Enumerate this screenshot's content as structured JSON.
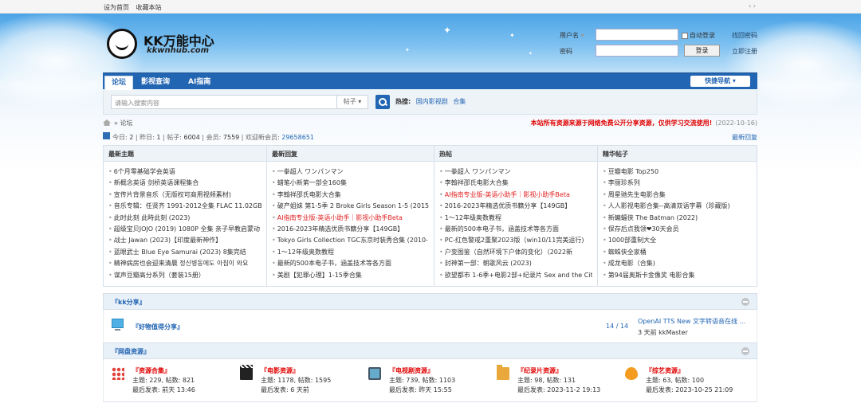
{
  "topbar": {
    "set_home": "设为首页",
    "bookmark": "收藏本站",
    "right": "‹ ›"
  },
  "logo": {
    "name": "KK万能中心",
    "url": "kkwnhub.com"
  },
  "login": {
    "username_label": "用户名",
    "password_label": "密码",
    "remember": "自动登录",
    "login_btn": "登录",
    "find_pwd": "找回密码",
    "register": "立即注册"
  },
  "nav": {
    "tabs": [
      "论坛",
      "影视查询",
      "AI指南"
    ],
    "quick": "快捷导航 ▾"
  },
  "search": {
    "placeholder": "请输入搜索内容",
    "type": "帖子 ▾",
    "hot_label": "热搜:",
    "hot_items": [
      "国内影视剧",
      "合集"
    ]
  },
  "breadcrumb": {
    "sep": "»",
    "current": "论坛",
    "notice": "本站所有资源来源于网络免费公开分享资源，仅供学习交流使用!",
    "date": "(2022-10-16)"
  },
  "stats": {
    "today_label": "今日:",
    "today": "2",
    "yesterday_label": "昨日:",
    "yesterday": "1",
    "posts_label": "帖子:",
    "posts": "6004",
    "members_label": "会员:",
    "members": "7559",
    "welcome_label": "欢迎新会员:",
    "new_member": "29658651",
    "latest_reply": "最新回复"
  },
  "columns": [
    {
      "title": "最新主题",
      "items": [
        {
          "text": "6个月零基础学会英语",
          "red": false
        },
        {
          "text": "新概念英语 剑桥英语课程集合",
          "red": false
        },
        {
          "text": "宣传片背景音乐（无版权可商用视频素材)",
          "red": false
        },
        {
          "text": "音乐专辑：任贤齐 1991-2012全集 FLAC 11.02GB",
          "red": false
        },
        {
          "text": "此时此刻 此時此刻 (2023)",
          "red": false
        },
        {
          "text": "超级宝贝JOJO (2019) 1080P 全集 亲子早教启蒙动",
          "red": false
        },
        {
          "text": "战士 Jawan (2023)【印度最新神作】",
          "red": false
        },
        {
          "text": "蓝眼武士 Blue Eye Samurai (2023) 8集完结",
          "red": false
        },
        {
          "text": "精神病房也会迎来清晨 정신병동에도 아침이 와요",
          "red": false
        },
        {
          "text": "谋声豆瓣高分系列（套装15册）",
          "red": false
        }
      ]
    },
    {
      "title": "最新回复",
      "items": [
        {
          "text": "一拳超人 ワンパンマン",
          "red": false
        },
        {
          "text": "蜡笔小新第一部全160集",
          "red": false
        },
        {
          "text": "李翰祥邵氏电影大合集",
          "red": false
        },
        {
          "text": "破产姐妹 第1-5季 2 Broke Girls Season 1-5 (2015)",
          "red": false
        },
        {
          "text": "AI指南专业版-英语小助手｜影视小助手Beta",
          "red": true
        },
        {
          "text": "2016-2023年精选优质书籍分享【149GB】",
          "red": false
        },
        {
          "text": "Tokyo Girls Collection TGC东京时装秀合集 (2010-",
          "red": false
        },
        {
          "text": "1～12年级奥数教程",
          "red": false
        },
        {
          "text": "最新的500本电子书，涵盖技术等各方面",
          "red": false
        },
        {
          "text": "美剧【犯罪心理】1-15季合集",
          "red": false
        }
      ]
    },
    {
      "title": "热帖",
      "items": [
        {
          "text": "一拳超人 ワンパンマン",
          "red": false
        },
        {
          "text": "李翰祥邵氏电影大合集",
          "red": false
        },
        {
          "text": "AI指南专业版-英语小助手｜影视小助手Beta",
          "red": true
        },
        {
          "text": "2016-2023年精选优质书籍分享【149GB】",
          "red": false
        },
        {
          "text": "1～12年级奥数教程",
          "red": false
        },
        {
          "text": "最新的500本电子书，涵盖技术等各方面",
          "red": false
        },
        {
          "text": "PC-红色警戒2重聚2023版（win10/11完美运行)",
          "red": false
        },
        {
          "text": "户变图鉴（自然环境下户体的变化）（2022新",
          "red": false
        },
        {
          "text": "封神第一部：朝歌风云 (2023)",
          "red": false
        },
        {
          "text": "欲望都市 1-6季+电影2部+纪录片 Sex and the City",
          "red": false
        }
      ]
    },
    {
      "title": "精华帖子",
      "items": [
        {
          "text": "豆瓣电影 Top250",
          "red": false
        },
        {
          "text": "李丽珍系列",
          "red": false
        },
        {
          "text": "周星驰先生电影合集",
          "red": false
        },
        {
          "text": "人人影视电影合集--高清双语字幕（珍藏版)",
          "red": false
        },
        {
          "text": "新蝙蝠侠 The Batman (2022)",
          "red": false
        },
        {
          "text": "保存后点我领❤30天会员",
          "red": false
        },
        {
          "text": "1000部重制大全",
          "red": false
        },
        {
          "text": "蜘蛛侠全家桶",
          "red": false
        },
        {
          "text": "成龙电影（合集)",
          "red": false
        },
        {
          "text": "第94届奥斯卡金像奖 电影合集",
          "red": false
        }
      ]
    }
  ],
  "section1": {
    "title": "『kk分享』",
    "forum": "『好物值得分享』",
    "count": "14 / 14",
    "last_title": "OpenAI TTS New 文字转语音在线 ...",
    "last_meta": "3 天前 kkMaster"
  },
  "section2": {
    "title": "『网盘资源』",
    "topics_label": "主题:",
    "posts_label": "帖数:",
    "last_label": "最后发表:",
    "forums": [
      {
        "name": "『资源合集』",
        "topics": "229",
        "posts": "821",
        "last": "前天 13:46"
      },
      {
        "name": "『电影资源』",
        "topics": "1178",
        "posts": "1595",
        "last": "6 天前"
      },
      {
        "name": "『电视剧资源』",
        "topics": "739",
        "posts": "1103",
        "last": "昨天 15:55"
      },
      {
        "name": "『纪录片资源』",
        "topics": "98",
        "posts": "131",
        "last": "2023-11-2 19:13"
      },
      {
        "name": "『综艺资源』",
        "topics": "63",
        "posts": "100",
        "last": "2023-10-25 21:09"
      }
    ]
  }
}
